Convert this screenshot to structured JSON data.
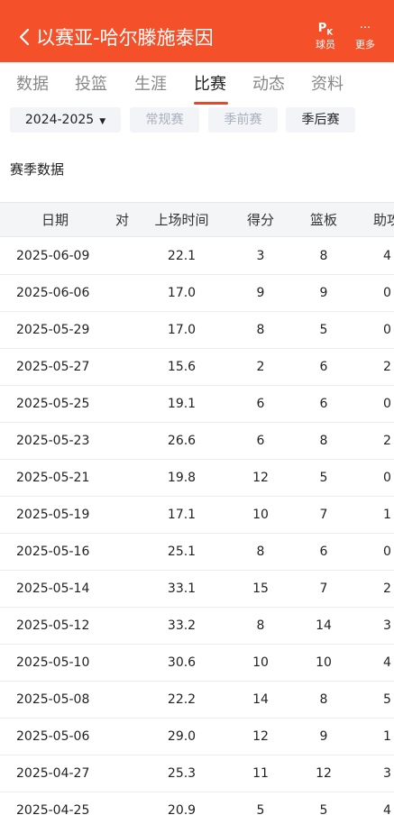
{
  "header": {
    "title": "以赛亚-哈尔滕施泰因",
    "player_btn_icon": "PK",
    "player_btn_label": "球员",
    "more_btn_icon": "···",
    "more_btn_label": "更多",
    "accent_color": "#f4502a"
  },
  "tabs": [
    "数据",
    "投篮",
    "生涯",
    "比赛",
    "动态",
    "资料"
  ],
  "active_tab": "比赛",
  "filters": {
    "season": "2024-2025",
    "regular": "常规赛",
    "preseason": "季前赛",
    "playoffs": "季后赛"
  },
  "section_title": "赛季数据",
  "table": {
    "headers": {
      "date": "日期",
      "stub": "对",
      "time": "上场时间",
      "points": "得分",
      "rebounds": "篮板",
      "assists": "助攻"
    },
    "rows": [
      {
        "date": "2025-06-09",
        "time": "22.1",
        "points": "3",
        "rebounds": "8",
        "assists": "4"
      },
      {
        "date": "2025-06-06",
        "time": "17.0",
        "points": "9",
        "rebounds": "9",
        "assists": "0"
      },
      {
        "date": "2025-05-29",
        "time": "17.0",
        "points": "8",
        "rebounds": "5",
        "assists": "0"
      },
      {
        "date": "2025-05-27",
        "time": "15.6",
        "points": "2",
        "rebounds": "6",
        "assists": "2"
      },
      {
        "date": "2025-05-25",
        "time": "19.1",
        "points": "6",
        "rebounds": "6",
        "assists": "0"
      },
      {
        "date": "2025-05-23",
        "time": "26.6",
        "points": "6",
        "rebounds": "8",
        "assists": "2"
      },
      {
        "date": "2025-05-21",
        "time": "19.8",
        "points": "12",
        "rebounds": "5",
        "assists": "0"
      },
      {
        "date": "2025-05-19",
        "time": "17.1",
        "points": "10",
        "rebounds": "7",
        "assists": "1"
      },
      {
        "date": "2025-05-16",
        "time": "25.1",
        "points": "8",
        "rebounds": "6",
        "assists": "0"
      },
      {
        "date": "2025-05-14",
        "time": "33.1",
        "points": "15",
        "rebounds": "7",
        "assists": "2"
      },
      {
        "date": "2025-05-12",
        "time": "33.2",
        "points": "8",
        "rebounds": "14",
        "assists": "3"
      },
      {
        "date": "2025-05-10",
        "time": "30.6",
        "points": "10",
        "rebounds": "10",
        "assists": "4"
      },
      {
        "date": "2025-05-08",
        "time": "22.2",
        "points": "14",
        "rebounds": "8",
        "assists": "5"
      },
      {
        "date": "2025-05-06",
        "time": "29.0",
        "points": "12",
        "rebounds": "9",
        "assists": "1"
      },
      {
        "date": "2025-04-27",
        "time": "25.3",
        "points": "11",
        "rebounds": "12",
        "assists": "3"
      },
      {
        "date": "2025-04-25",
        "time": "20.9",
        "points": "5",
        "rebounds": "5",
        "assists": "4"
      }
    ]
  }
}
